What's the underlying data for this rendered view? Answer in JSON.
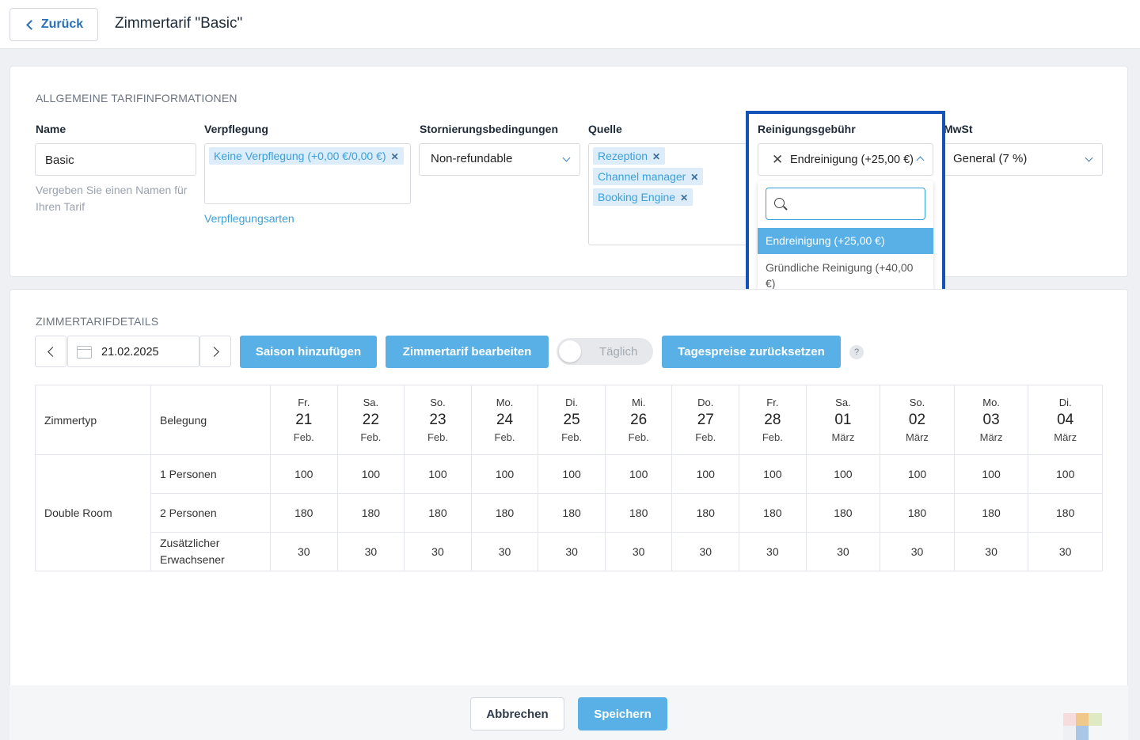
{
  "header": {
    "back_label": "Zurück",
    "title": "Zimmertarif \"Basic\""
  },
  "general": {
    "section_title": "ALLGEMEINE TARIFINFORMATIONEN",
    "name": {
      "label": "Name",
      "value": "Basic",
      "hint": "Vergeben Sie einen Namen für Ihren Tarif"
    },
    "meals": {
      "label": "Verpflegung",
      "tags": [
        "Keine Verpflegung (+0,00 €/0,00 €)"
      ],
      "link": "Verpflegungsarten"
    },
    "cancellation": {
      "label": "Stornierungsbedingungen",
      "value": "Non-refundable"
    },
    "source": {
      "label": "Quelle",
      "tags": [
        "Rezeption",
        "Channel manager",
        "Booking Engine"
      ]
    },
    "cleaning": {
      "label": "Reinigungsgebühr",
      "value": "Endreinigung (+25,00 €)",
      "options": [
        "Endreinigung (+25,00 €)",
        "Gründliche Reinigung (+40,00 €)"
      ],
      "highlight_color": "#1452b8"
    },
    "vat": {
      "label": "MwSt",
      "value": "General (7 %)"
    }
  },
  "details": {
    "section_title": "ZIMMERTARIFDETAILS",
    "date": "21.02.2025",
    "add_season": "Saison hinzufügen",
    "edit_rate": "Zimmertarif bearbeiten",
    "toggle_label": "Täglich",
    "reset_prices": "Tagespreise zurücksetzen",
    "help": "?"
  },
  "table": {
    "col_room": "Zimmertyp",
    "col_occ": "Belegung",
    "days": [
      {
        "dow": "Fr.",
        "day": "21",
        "month": "Feb."
      },
      {
        "dow": "Sa.",
        "day": "22",
        "month": "Feb."
      },
      {
        "dow": "So.",
        "day": "23",
        "month": "Feb."
      },
      {
        "dow": "Mo.",
        "day": "24",
        "month": "Feb."
      },
      {
        "dow": "Di.",
        "day": "25",
        "month": "Feb."
      },
      {
        "dow": "Mi.",
        "day": "26",
        "month": "Feb."
      },
      {
        "dow": "Do.",
        "day": "27",
        "month": "Feb."
      },
      {
        "dow": "Fr.",
        "day": "28",
        "month": "Feb."
      },
      {
        "dow": "Sa.",
        "day": "01",
        "month": "März"
      },
      {
        "dow": "So.",
        "day": "02",
        "month": "März"
      },
      {
        "dow": "Mo.",
        "day": "03",
        "month": "März"
      },
      {
        "dow": "Di.",
        "day": "04",
        "month": "März"
      }
    ],
    "room": "Double Room",
    "rows": [
      {
        "occupancy": "1 Personen",
        "values": [
          "100",
          "100",
          "100",
          "100",
          "100",
          "100",
          "100",
          "100",
          "100",
          "100",
          "100",
          "100"
        ]
      },
      {
        "occupancy": "2 Personen",
        "values": [
          "180",
          "180",
          "180",
          "180",
          "180",
          "180",
          "180",
          "180",
          "180",
          "180",
          "180",
          "180"
        ]
      },
      {
        "occupancy": "Zusätzlicher Erwachsener",
        "values": [
          "30",
          "30",
          "30",
          "30",
          "30",
          "30",
          "30",
          "30",
          "30",
          "30",
          "30",
          "30"
        ]
      }
    ]
  },
  "footer": {
    "cancel": "Abbrechen",
    "save": "Speichern"
  },
  "colors": {
    "accent": "#58b0e6",
    "link": "#3aa0dc",
    "tag_bg": "#dcecf8"
  }
}
